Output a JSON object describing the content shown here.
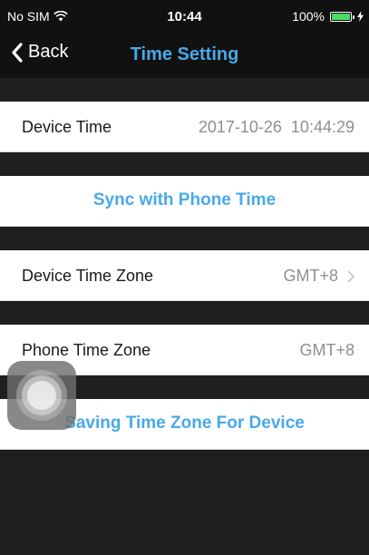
{
  "status_bar": {
    "carrier": "No SIM",
    "time": "10:44",
    "battery": "100%",
    "battery_level": 1.0,
    "battery_color": "#4cd964",
    "wifi_icon": "wifi-icon",
    "charging_icon": "charging-bolt-icon"
  },
  "nav": {
    "back_label": "Back",
    "title": "Time Setting",
    "accent_color": "#49a9e8"
  },
  "rows": {
    "device_time": {
      "label": "Device Time",
      "value": "2017-10-26  10:44:29"
    },
    "sync": {
      "label": "Sync with Phone Time"
    },
    "device_time_zone": {
      "label": "Device Time Zone",
      "value": "GMT+8",
      "icon": "chevron-right-icon"
    },
    "phone_time_zone": {
      "label": "Phone Time Zone",
      "value": "GMT+8"
    },
    "save": {
      "label": "Saving Time Zone For Device"
    }
  }
}
